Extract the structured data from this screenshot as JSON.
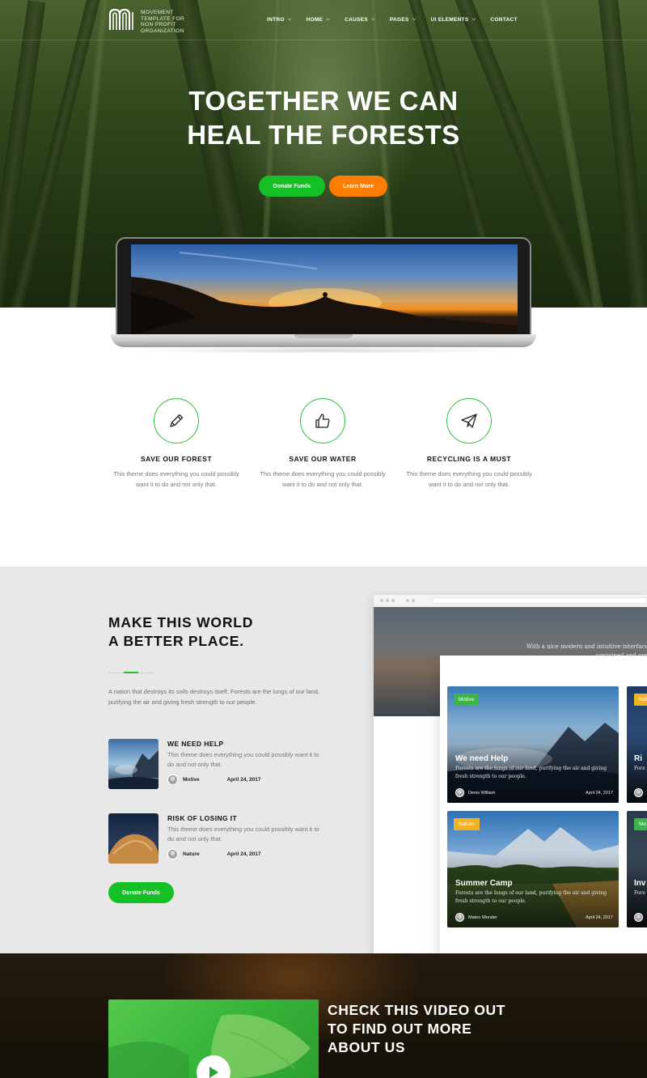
{
  "brand": {
    "name_lines": [
      "MOVEMENT",
      "TEMPLATE FOR",
      "NON PROFIT",
      "ORGANIZATION"
    ]
  },
  "nav": [
    {
      "label": "INTRO",
      "has_dropdown": true
    },
    {
      "label": "HOME",
      "has_dropdown": true
    },
    {
      "label": "CAUSES",
      "has_dropdown": true
    },
    {
      "label": "PAGES",
      "has_dropdown": true
    },
    {
      "label": "UI ELEMENTS",
      "has_dropdown": true
    },
    {
      "label": "CONTACT",
      "has_dropdown": false
    }
  ],
  "hero": {
    "title_lines": [
      "TOGETHER WE CAN",
      "HEAL THE FORESTS"
    ],
    "donate_label": "Donate Funds",
    "learn_label": "Learn More"
  },
  "features": [
    {
      "icon": "pencil-icon",
      "title": "SAVE OUR FOREST",
      "text": "This theme does everything you could possibly want it to do and not only that."
    },
    {
      "icon": "thumbs-up-icon",
      "title": "SAVE OUR WATER",
      "text": "This theme does everything you could possibly want it to do and not only that."
    },
    {
      "icon": "paper-plane-icon",
      "title": "RECYCLING IS A MUST",
      "text": "This theme does everything you could possibly want it to do and not only that."
    }
  ],
  "about": {
    "title_lines": [
      "MAKE THIS WORLD",
      "A BETTER PLACE."
    ],
    "text": "A nation that destroys its soils destroys itself. Forests are the lungs of our land, purifying the air and giving fresh strength to our people.",
    "posts": [
      {
        "title": "WE NEED HELP",
        "text": "This theme does everything you could possibly want it to do and not only that.",
        "author": "Motive",
        "date": "April 24, 2017"
      },
      {
        "title": "RISK OF LOSING IT",
        "text": "This theme does everything you could possibly want it to do and not only that.",
        "author": "Nature",
        "date": "April 24, 2017"
      }
    ],
    "donate_label": "Donate Funds"
  },
  "preview": {
    "hero_text_lines": [
      "With a nice modern and intuitive interface yo",
      "contained and organi"
    ],
    "cards": [
      {
        "badge": "Motive",
        "badge_color": "#3cb54a",
        "title": "We need Help",
        "text": "Forests are the lungs of our land, purifying the air and giving fresh strength to our people.",
        "author": "Denis William",
        "date": "April 24, 2017"
      },
      {
        "badge": "Nature",
        "badge_color": "#f0b323",
        "title": "Summer Camp",
        "text": "Forests are the lungs of our land, purifying the air and giving fresh strength to our people.",
        "author": "Mateo Wonder",
        "date": "April 24, 2017"
      }
    ],
    "side_cards": [
      {
        "badge": "Nat",
        "badge_color": "#f0b323",
        "title": "Ri",
        "text": "Fore fresh"
      },
      {
        "badge": "Mo",
        "badge_color": "#3cb54a",
        "title": "Inv",
        "text": "Fore fresh"
      }
    ]
  },
  "video": {
    "title_lines": [
      "CHECK THIS VIDEO OUT",
      "TO FIND OUT MORE",
      "ABOUT US"
    ]
  },
  "colors": {
    "primary_green": "#15c027",
    "accent_orange": "#ff7e00",
    "badge_green": "#3cb54a",
    "badge_yellow": "#f0b323"
  }
}
